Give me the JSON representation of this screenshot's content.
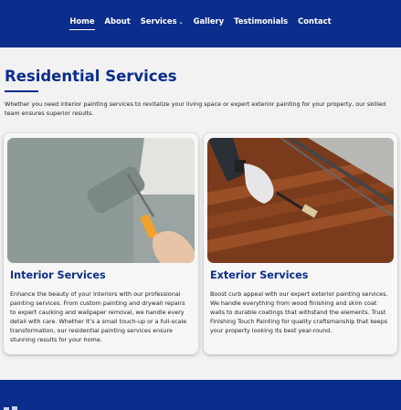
{
  "nav": {
    "items": [
      {
        "label": "Home",
        "active": true
      },
      {
        "label": "About",
        "active": false
      },
      {
        "label": "Services",
        "active": false,
        "dropdown": true
      },
      {
        "label": "Gallery",
        "active": false
      },
      {
        "label": "Testimonials",
        "active": false
      },
      {
        "label": "Contact",
        "active": false
      }
    ]
  },
  "main": {
    "title": "Residential Services",
    "intro": "Whether you need interior painting services to revitalize your living space or expert exterior painting for your property, our skilled team ensures superior results.",
    "cards": [
      {
        "title": "Interior Services",
        "text": "Enhance the beauty of your interiors with our professional painting services. From custom painting and drywall repairs to expert caulking and wallpaper removal, we handle every detail with care. Whether it’s a small touch-up or a full-scale transformation, our residential painting services ensure stunning results for your home."
      },
      {
        "title": "Exterior Services",
        "text": "Boost curb appeal with our expert exterior painting services. We handle everything from wood finishing and skim coat walls to durable coatings that withstand the elements. Trust Finishing Touch Painting for quality craftsmanship that keeps your property looking its best year-round."
      }
    ]
  },
  "colors": {
    "brand": "#0b2d8c",
    "background": "#f2f2f2",
    "card": "#f7f7f7"
  }
}
